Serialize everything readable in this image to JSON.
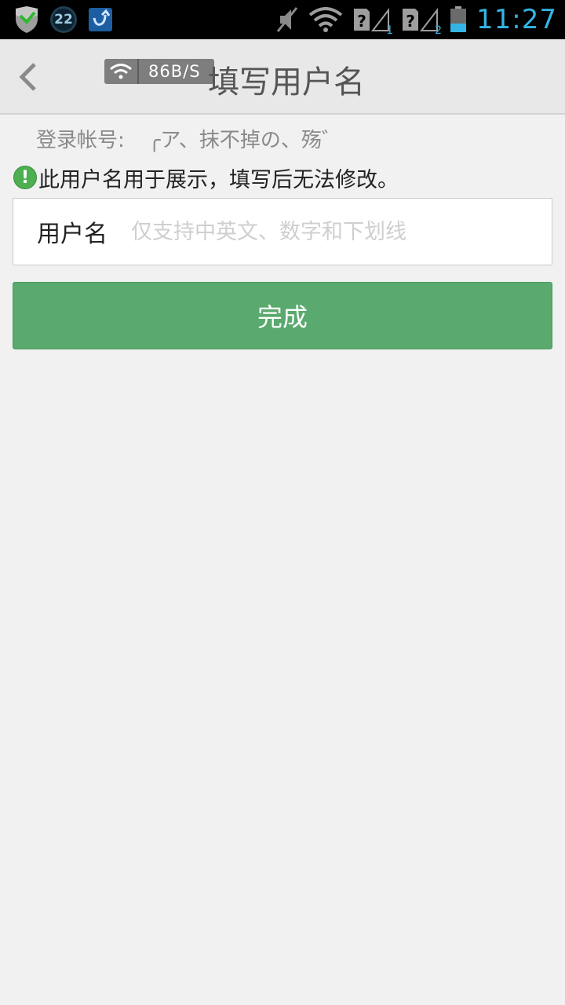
{
  "status_bar": {
    "notification_badge": "22",
    "sim1_index": "1",
    "sim2_index": "2",
    "time": "11:27",
    "accent_color": "#33b5e5"
  },
  "header": {
    "network_speed": "86B/S",
    "title": "填写用户名"
  },
  "account": {
    "label": "登录帐号:",
    "value": "╭ア、抹不掉の、殇゛"
  },
  "tip": {
    "text": "此用户名用于展示，填写后无法修改。"
  },
  "form": {
    "username_label": "用户名",
    "username_value": "",
    "username_placeholder": "仅支持中英文、数字和下划线"
  },
  "actions": {
    "done_label": "完成",
    "done_color": "#5aa96e"
  }
}
